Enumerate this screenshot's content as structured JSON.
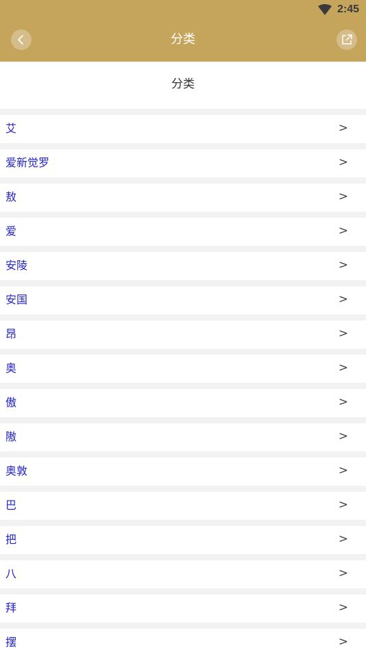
{
  "status_bar": {
    "time": "2:45",
    "wifi_icon": "wifi-icon"
  },
  "nav": {
    "title": "分类",
    "back_icon": "chevron-left-icon",
    "share_icon": "share-external-icon"
  },
  "subheader": {
    "title": "分类"
  },
  "colors": {
    "header_bg": "#c5a45c",
    "link_text": "#2323c8",
    "page_bg": "#f2f2f2"
  },
  "list": {
    "arrow": ">",
    "items": [
      {
        "label": "艾"
      },
      {
        "label": "爱新觉罗"
      },
      {
        "label": "敖"
      },
      {
        "label": "爱"
      },
      {
        "label": "安陵"
      },
      {
        "label": "安国"
      },
      {
        "label": "昂"
      },
      {
        "label": "奥"
      },
      {
        "label": "傲"
      },
      {
        "label": "隞"
      },
      {
        "label": "奥敦"
      },
      {
        "label": "巴"
      },
      {
        "label": "把"
      },
      {
        "label": "八"
      },
      {
        "label": "拜"
      },
      {
        "label": "摆"
      }
    ]
  }
}
